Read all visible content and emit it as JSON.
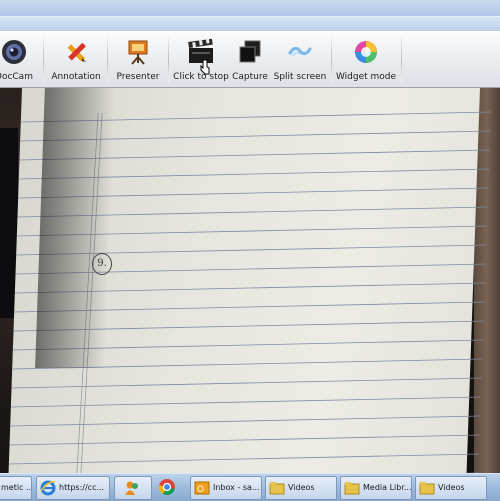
{
  "toolbar": {
    "items": [
      {
        "label": "DocCam",
        "icon": "webcam-icon"
      },
      {
        "label": "Annotation",
        "icon": "pencil-ruler-icon"
      },
      {
        "label": "Presenter",
        "icon": "presentation-easel-icon"
      },
      {
        "label": "Click to stop",
        "icon": "clapperboard-icon"
      },
      {
        "label": "Capture",
        "icon": "capture-photos-icon"
      },
      {
        "label": "Split screen",
        "icon": "split-screen-icon"
      },
      {
        "label": "Widget mode",
        "icon": "color-wheel-icon"
      }
    ]
  },
  "camera": {
    "page_number": "9."
  },
  "taskbar": {
    "items": [
      {
        "label": "metic ...",
        "icon": "app-icon"
      },
      {
        "label": "https://cc...",
        "icon": "internet-explorer-icon"
      },
      {
        "label": "",
        "icon": "messenger-icon"
      },
      {
        "label": "",
        "icon": "chrome-icon"
      },
      {
        "label": "Inbox - sa...",
        "icon": "outlook-icon"
      },
      {
        "label": "Videos",
        "icon": "folder-icon"
      },
      {
        "label": "Media Libr...",
        "icon": "folder-icon"
      },
      {
        "label": "Videos",
        "icon": "folder-icon"
      }
    ]
  },
  "colors": {
    "toolbar_bg": "#e9ecef",
    "taskbar_bg": "#9ebbdc",
    "paper": "#e6e6de",
    "ruled_line": "#7f8aa0"
  }
}
